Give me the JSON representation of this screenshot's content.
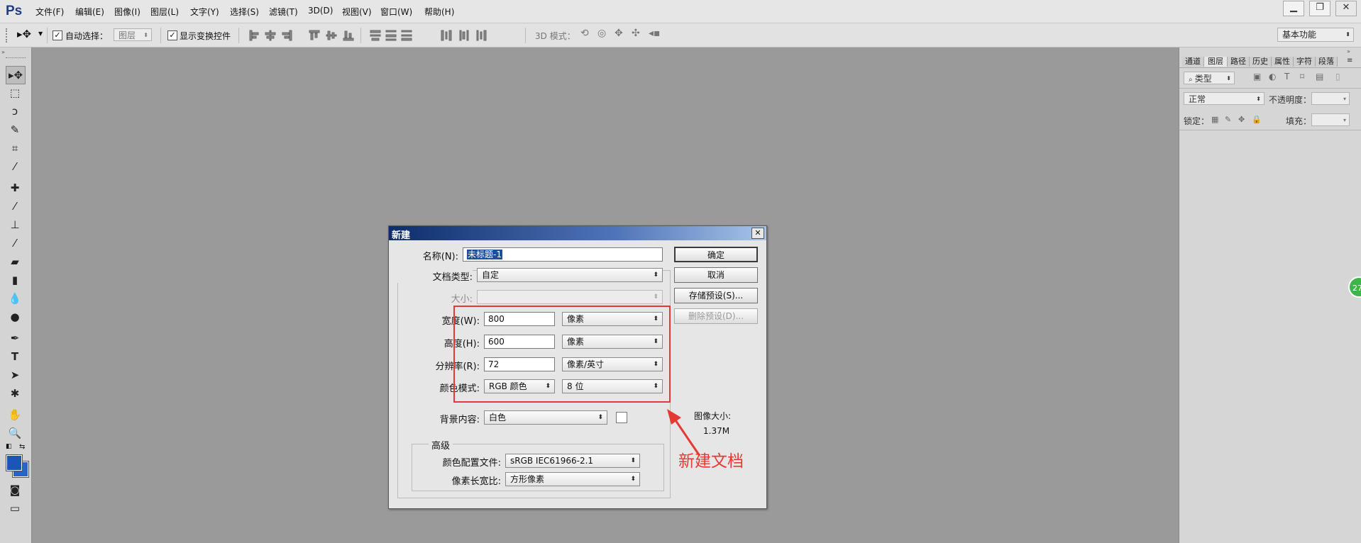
{
  "app": {
    "logo": "Ps"
  },
  "menu": [
    "文件(F)",
    "编辑(E)",
    "图像(I)",
    "图层(L)",
    "文字(Y)",
    "选择(S)",
    "滤镜(T)",
    "3D(D)",
    "视图(V)",
    "窗口(W)",
    "帮助(H)"
  ],
  "window_controls": {
    "minimize": "▁",
    "restore": "❐",
    "close": "✕"
  },
  "options": {
    "auto_select_label": "自动选择：",
    "auto_select_value": "图层",
    "show_transform_label": "显示变换控件",
    "mode_3d_label": "3D 模式：",
    "workspace": "基本功能"
  },
  "panel": {
    "tabs": [
      "通道",
      "图层",
      "路径",
      "历史",
      "属性",
      "字符",
      "段落"
    ],
    "filter_value": "类型",
    "blend_mode": "正常",
    "opacity_label": "不透明度：",
    "lock_label": "锁定：",
    "fill_label": "填充："
  },
  "dialog": {
    "title": "新建",
    "name_label": "名称(N):",
    "name_value": "未标题-1",
    "preset_label": "文档类型:",
    "preset_value": "自定",
    "size_label": "大小:",
    "width_label": "宽度(W):",
    "width_value": "800",
    "width_unit": "像素",
    "height_label": "高度(H):",
    "height_value": "600",
    "height_unit": "像素",
    "resolution_label": "分辨率(R):",
    "resolution_value": "72",
    "resolution_unit": "像素/英寸",
    "color_mode_label": "颜色模式:",
    "color_mode_value": "RGB 颜色",
    "bit_depth": "8 位",
    "background_label": "背景内容:",
    "background_value": "白色",
    "advanced_label": "高级",
    "color_profile_label": "颜色配置文件:",
    "color_profile_value": "sRGB IEC61966-2.1",
    "pixel_aspect_label": "像素长宽比:",
    "pixel_aspect_value": "方形像素",
    "ok_button": "确定",
    "cancel_button": "取消",
    "save_preset_button": "存储预设(S)...",
    "delete_preset_button": "删除预设(D)...",
    "image_size_label": "图像大小:",
    "image_size_value": "1.37M"
  },
  "annotation": {
    "text": "新建文档",
    "color": "#e53935"
  },
  "side_badge": "27",
  "colors": {
    "accent": "#1f5fbf",
    "highlight": "#e53935",
    "title_bar": "#0d2d6b"
  }
}
